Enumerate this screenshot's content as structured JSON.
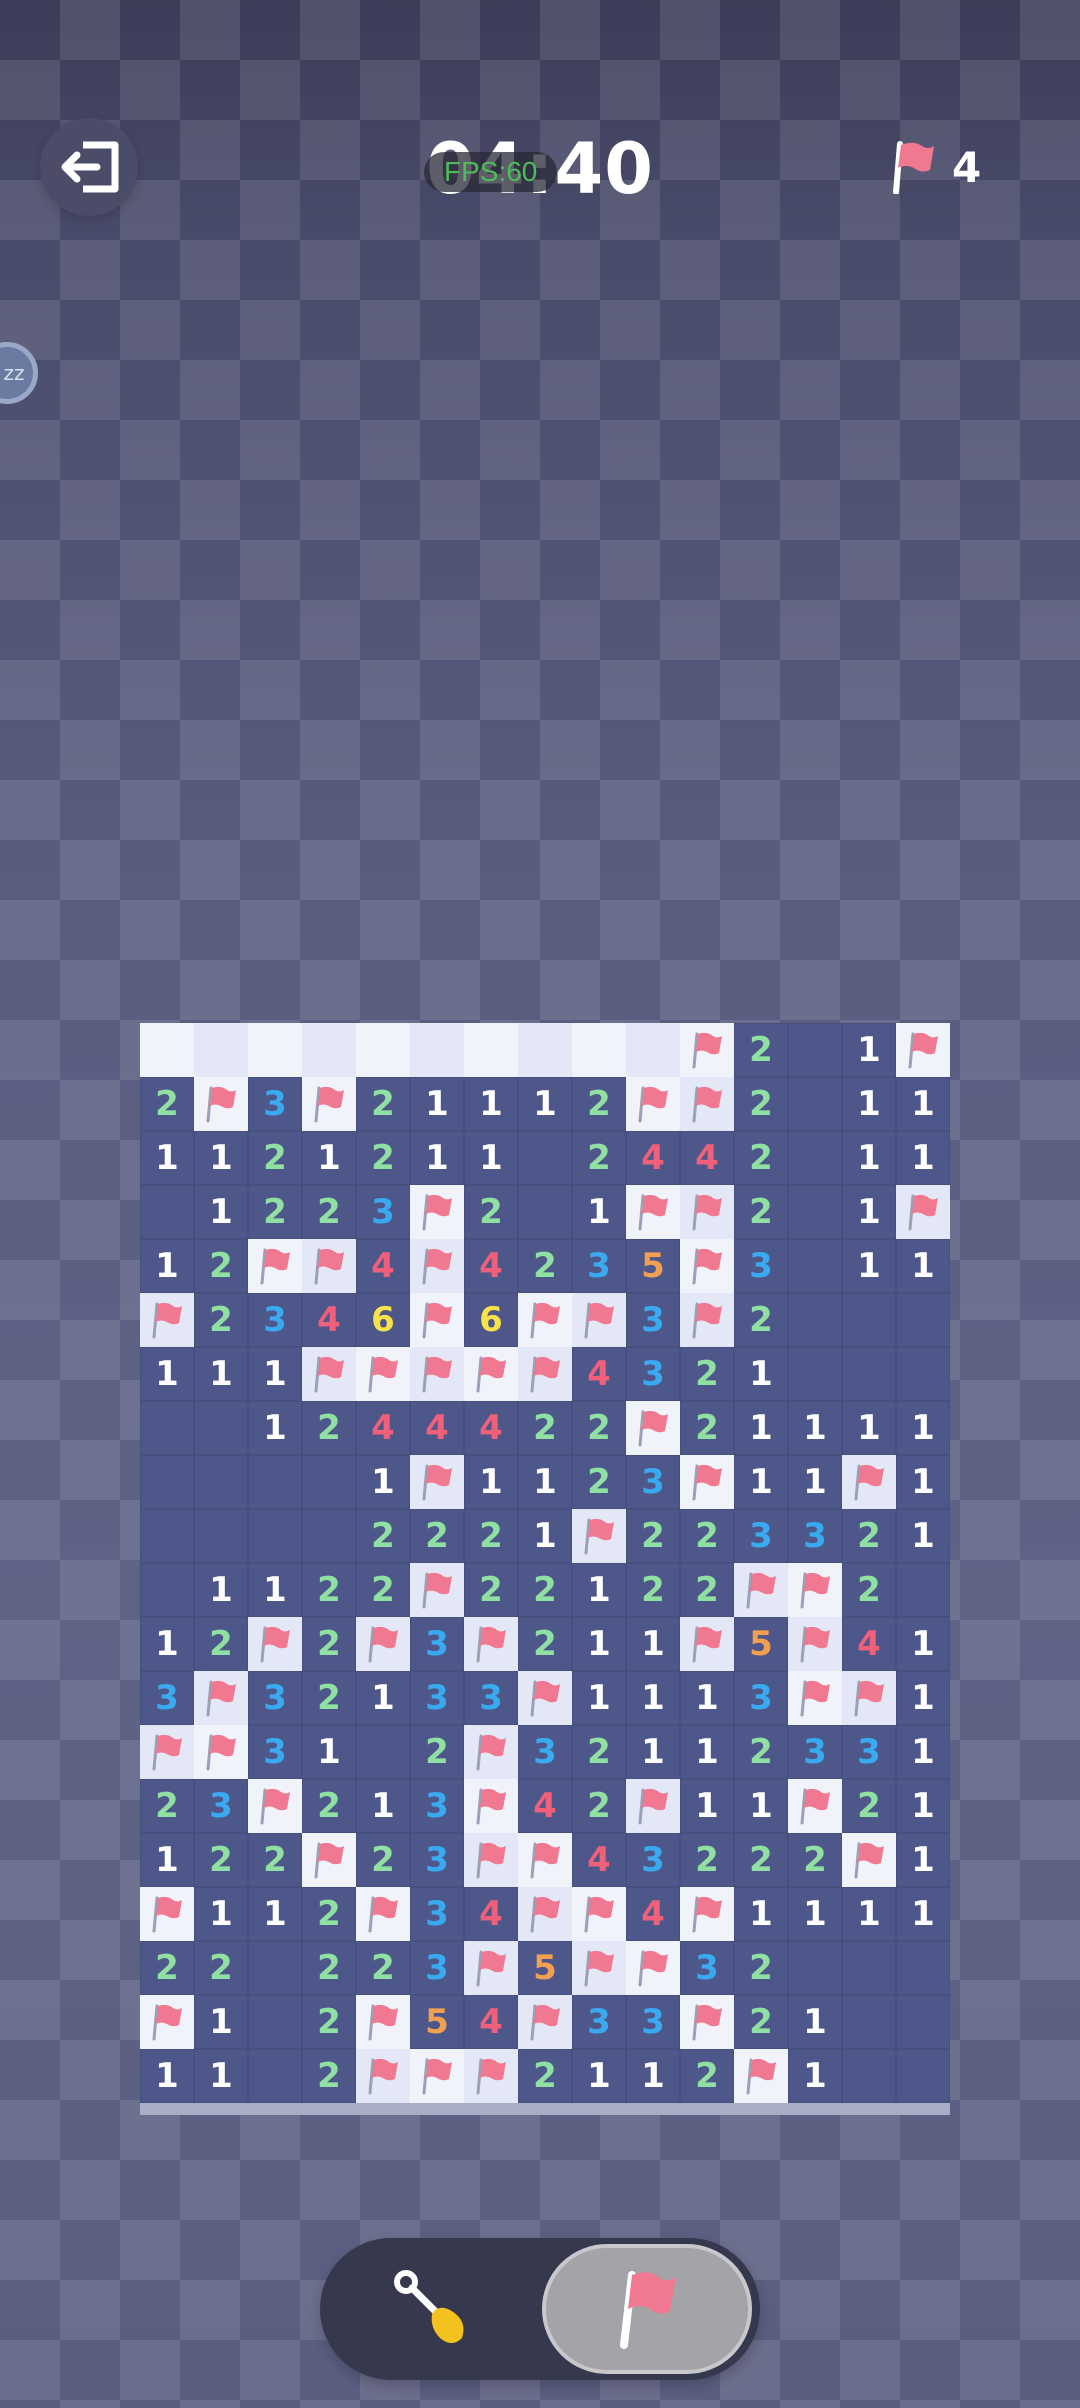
{
  "header": {
    "timer": "04:40",
    "fps_label": "FPS:60",
    "flags_remaining": "4"
  },
  "side_badge": "zz",
  "board": {
    "cols": 15,
    "rows": [
      "UUUUUUUUUUUF2.1F",
      "2F3F21112FF2.11",
      "112121124 42.11",
      ".1223F2.1FF2.1F",
      "12FF4F4235F3.11",
      "F234 6F6FF3F2...",
      "111FFFFF4321...",
      "..1244422F21111",
      "....1F112 3F11F1",
      "....2221F2233 21",
      ".11 22F22122FF2.",
      "12F2F3F211F5F41",
      "3F321 33F1113FF1",
      "FF31.2F321123 31",
      "23F213F42F11F21",
      "122F23FF43222F1",
      "F112F34FF4F1111",
      "22.223F5FF32...",
      "F1.2F54F33F21..",
      "11.2FFF2112F1.."
    ],
    "note": "row strings kept for reference only"
  },
  "cells": [
    [
      "U",
      "U",
      "U",
      "U",
      "U",
      "U",
      "U",
      "U",
      "U",
      "U",
      "F",
      "2",
      ".",
      "1",
      "F"
    ],
    [
      "2",
      "F",
      "3",
      "F",
      "2",
      "1",
      "1",
      "1",
      "2",
      "F",
      "F",
      "2",
      ".",
      "1",
      "1"
    ],
    [
      "1",
      "1",
      "2",
      "1",
      "2",
      "1",
      "1",
      ".",
      "2",
      "4",
      "4",
      "2",
      ".",
      "1",
      "1"
    ],
    [
      ".",
      "1",
      "2",
      "2",
      "3",
      "F",
      "2",
      ".",
      "1",
      "F",
      "F",
      "2",
      ".",
      "1",
      "F"
    ],
    [
      "1",
      "2",
      "F",
      "F",
      "4",
      "F",
      "4",
      "2",
      "3",
      "5",
      "F",
      "3",
      ".",
      "1",
      "1"
    ],
    [
      "F",
      "2",
      "3",
      "4",
      "6",
      "F",
      "6",
      "F",
      "F",
      "3",
      "F",
      "2",
      ".",
      ".",
      "."
    ],
    [
      "1",
      "1",
      "1",
      "F",
      "F",
      "F",
      "F",
      "F",
      "4",
      "3",
      "2",
      "1",
      ".",
      ".",
      "."
    ],
    [
      ".",
      ".",
      "1",
      "2",
      "4",
      "4",
      "4",
      "2",
      "2",
      "F",
      "2",
      "1",
      "1",
      "1",
      "1"
    ],
    [
      ".",
      ".",
      ".",
      ".",
      "1",
      "F",
      "1",
      "1",
      "2",
      "3",
      "F",
      "1",
      "1",
      "F",
      "1"
    ],
    [
      ".",
      ".",
      ".",
      ".",
      "2",
      "2",
      "2",
      "1",
      "F",
      "2",
      "2",
      "3",
      "3",
      "2",
      "1"
    ],
    [
      ".",
      "1",
      "1",
      "2",
      "2",
      "F",
      "2",
      "2",
      "1",
      "2",
      "2",
      "F",
      "F",
      "2",
      "."
    ],
    [
      "1",
      "2",
      "F",
      "2",
      "F",
      "3",
      "F",
      "2",
      "1",
      "1",
      "F",
      "5",
      "F",
      "4",
      "1"
    ],
    [
      "3",
      "F",
      "3",
      "2",
      "1",
      "3",
      "3",
      "F",
      "1",
      "1",
      "1",
      "3",
      "F",
      "F",
      "1"
    ],
    [
      "F",
      "F",
      "3",
      "1",
      ".",
      "2",
      "F",
      "3",
      "2",
      "1",
      "1",
      "2",
      "3",
      "3",
      "1"
    ],
    [
      "2",
      "3",
      "F",
      "2",
      "1",
      "3",
      "F",
      "4",
      "2",
      "F",
      "1",
      "1",
      "F",
      "2",
      "1"
    ],
    [
      "1",
      "2",
      "2",
      "F",
      "2",
      "3",
      "F",
      "F",
      "4",
      "3",
      "2",
      "2",
      "2",
      "F",
      "1"
    ],
    [
      "F",
      "1",
      "1",
      "2",
      "F",
      "3",
      "4",
      "F",
      "F",
      "4",
      "F",
      "1",
      "1",
      "1",
      "1"
    ],
    [
      "2",
      "2",
      ".",
      "2",
      "2",
      "3",
      "F",
      "5",
      "F",
      "F",
      "3",
      "2",
      ".",
      ".",
      "."
    ],
    [
      "F",
      "1",
      ".",
      "2",
      "F",
      "5",
      "4",
      "F",
      "3",
      "3",
      "F",
      "2",
      "1",
      ".",
      "."
    ],
    [
      "1",
      "1",
      ".",
      "2",
      "F",
      "F",
      "F",
      "2",
      "1",
      "1",
      "2",
      "F",
      "1",
      ".",
      "."
    ]
  ],
  "controls": {
    "mode_selected": "flag",
    "modes": [
      "dig",
      "flag"
    ]
  },
  "colors": {
    "accent_flag": "#f07890",
    "revealed_cell": "#4d5789",
    "unrevealed_cell": "#f1f3fb"
  }
}
